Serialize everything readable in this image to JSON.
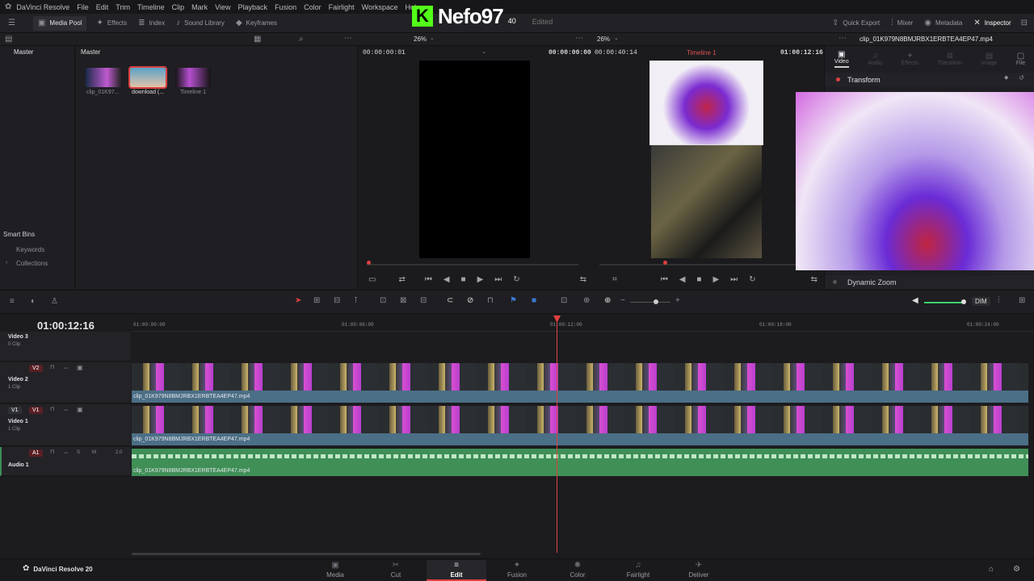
{
  "app": {
    "title": "DaVinci Resolve",
    "menu": [
      "File",
      "Edit",
      "Trim",
      "Timeline",
      "Clip",
      "Mark",
      "View",
      "Playback",
      "Fusion",
      "Color",
      "Fairlight",
      "Workspace",
      "Help"
    ],
    "watermark": "Nefo97",
    "watermark_sub": "40",
    "edited": "Edited"
  },
  "toolbar": {
    "media_pool": "Media Pool",
    "effects": "Effects",
    "index": "Index",
    "sound_library": "Sound Library",
    "keyframes": "Keyframes",
    "quick_export": "Quick Export",
    "mixer": "Mixer",
    "metadata": "Metadata",
    "inspector": "Inspector"
  },
  "subbar": {
    "zoom_left": "26%",
    "zoom_right": "26%",
    "clip_name": "clip_01K979N8BMJRBX1ERBTEA4EP47.mp4"
  },
  "left": {
    "master": "Master",
    "smart_bins": "Smart Bins",
    "keywords": "Keywords",
    "collections": "Collections"
  },
  "pool": {
    "header": "Master",
    "items": [
      "clip_01K97...",
      "download (...",
      "Timeline 1"
    ]
  },
  "viewer": {
    "tc_src": "00:00:00:01",
    "tc_dur": "00:00:00:00",
    "tc_rec": "00:00:40:14",
    "timeline_name": "Timeline 1",
    "tc_cur": "01:00:12:16"
  },
  "inspector": {
    "tabs": [
      "Video",
      "Audio",
      "Effects",
      "Transition",
      "Image",
      "File"
    ],
    "transform": "Transform",
    "dynamic_zoom": "Dynamic Zoom"
  },
  "timeline": {
    "timecode": "01:00:12:16",
    "ruler": [
      "01:00:00:00",
      "01:00:06:00",
      "01:00:12:00",
      "01:00:18:00",
      "01:00:24:00"
    ],
    "tracks": [
      {
        "name": "Video 3",
        "count": "0 Clip"
      },
      {
        "tag": "V2",
        "name": "Video 2",
        "count": "1 Clip",
        "clip": "clip_01K979N8BMJRBX1ERBTEA4EP47.mp4"
      },
      {
        "tag": "V1",
        "name": "Video 1",
        "count": "1 Clip",
        "clip": "clip_01K979N8BMJRBX1ERBTEA4EP47.mp4"
      },
      {
        "tag": "A1",
        "name": "Audio 1",
        "level": "2.0",
        "clip": "clip_01K979N8BMJRBX1ERBTEA4EP47.mp4"
      }
    ],
    "dim": "DIM",
    "v1": "V1",
    "m": "M",
    "s": "S"
  },
  "pages": [
    "Media",
    "Cut",
    "Edit",
    "Fusion",
    "Color",
    "Fairlight",
    "Deliver"
  ],
  "footer": {
    "brand": "DaVinci Resolve 20"
  },
  "colors": {
    "accent": "#e64a4a",
    "playhead": "#e04040",
    "active_tab": "#ffffff",
    "audio": "#3f8f57",
    "video_clip": "#4b6f86"
  }
}
